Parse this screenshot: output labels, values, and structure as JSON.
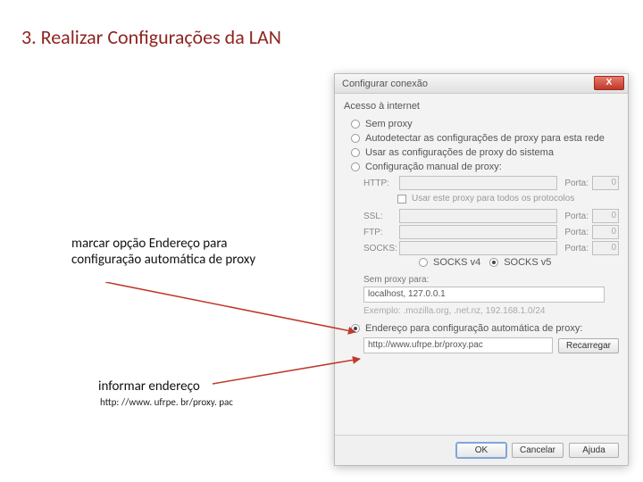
{
  "slide": {
    "title": "3. Realizar Configurações da LAN"
  },
  "dialog": {
    "title": "Configurar conexão",
    "close": "X",
    "section": "Acesso à internet",
    "options": {
      "no_proxy": "Sem proxy",
      "autodetect": "Autodetectar as configurações de proxy para esta rede",
      "system": "Usar as configurações de proxy do sistema",
      "manual": "Configuração manual de proxy:",
      "pac": "Endereço para configuração automática de proxy:"
    },
    "fields": {
      "http": "HTTP:",
      "ssl": "SSL:",
      "ftp": "FTP:",
      "socks": "SOCKS:",
      "port": "Porta:",
      "port_val": "0",
      "same_all": "Usar este proxy para todos os protocolos",
      "socks4": "SOCKS v4",
      "socks5": "SOCKS v5"
    },
    "noproxy_label": "Sem proxy para:",
    "noproxy_value": "localhost, 127.0.0.1",
    "example": "Exemplo: .mozilla.org, .net.nz, 192.168.1.0/24",
    "pac_value": "http://www.ufrpe.br/proxy.pac",
    "reload": "Recarregar",
    "buttons": {
      "ok": "OK",
      "cancel": "Cancelar",
      "help": "Ajuda"
    }
  },
  "annotations": {
    "mark_option": "marcar opção Endereço para configuração automática de proxy",
    "enter_addr": "informar endereço",
    "enter_addr_sub": "http: //www. ufrpe. br/proxy. pac"
  }
}
